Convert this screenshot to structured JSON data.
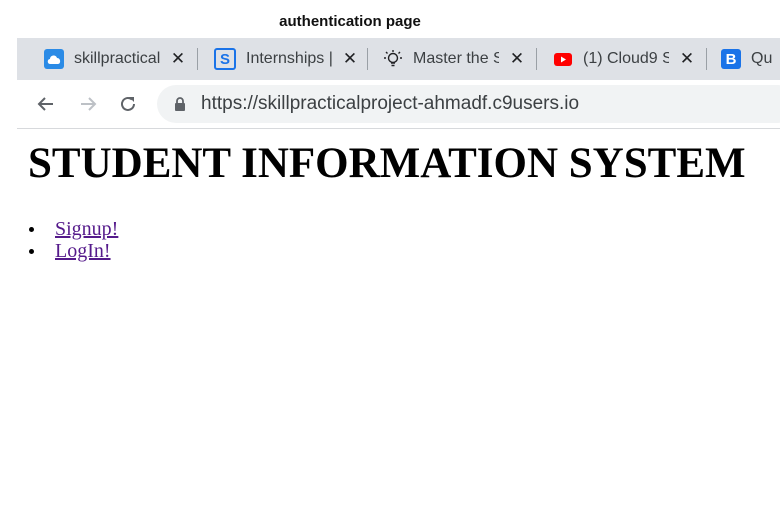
{
  "caption": "authentication page",
  "browser": {
    "tabs": [
      {
        "title": "skillpractical",
        "favicon": "cloud9-icon",
        "color": "#2b8be6"
      },
      {
        "title": "Internships |",
        "favicon": "internshala-icon",
        "color": "#1a73e8"
      },
      {
        "title": "Master the S",
        "favicon": "lightbulb-icon",
        "color": "#202124"
      },
      {
        "title": "(1) Cloud9 S",
        "favicon": "youtube-icon",
        "color": "#ff0000"
      },
      {
        "title": "Qu",
        "favicon": "bootstrap-b-icon",
        "color": "#1a73e8"
      }
    ],
    "close_glyph": "✕",
    "url": "https://skillpracticalproject-ahmadf.c9users.io"
  },
  "page": {
    "heading": "STUDENT INFORMATION SYSTEM",
    "links": [
      {
        "label": "Signup!"
      },
      {
        "label": "LogIn!"
      }
    ]
  },
  "colors": {
    "visited_link": "#551a8b",
    "tab_strip": "#dee1e6",
    "omnibox": "#f1f3f4"
  }
}
